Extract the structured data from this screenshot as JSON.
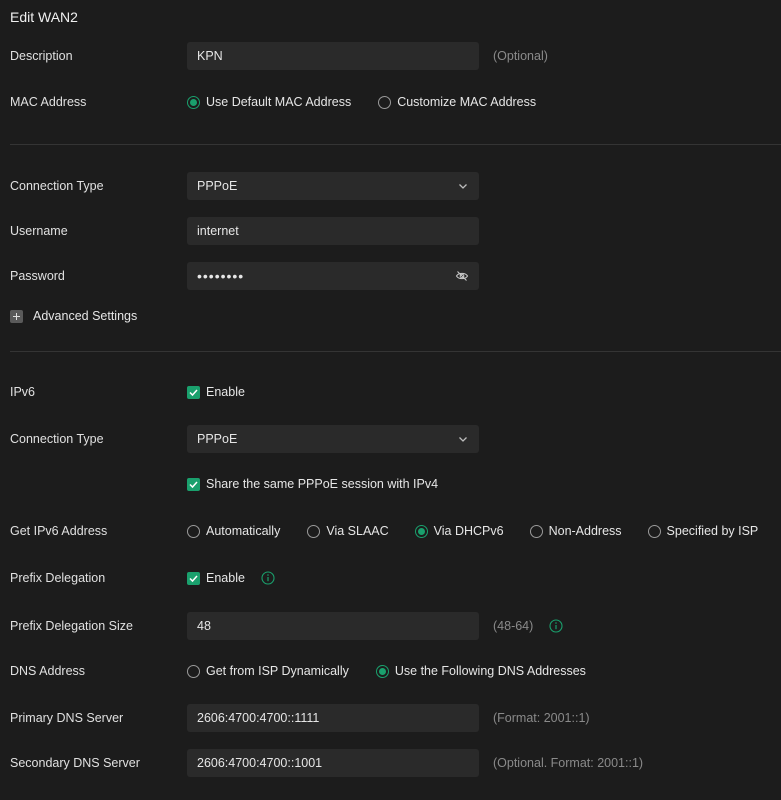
{
  "page": {
    "title": "Edit WAN2"
  },
  "description": {
    "label": "Description",
    "value": "KPN",
    "hint": "(Optional)"
  },
  "mac_address": {
    "label": "MAC Address",
    "options": [
      "Use Default MAC Address",
      "Customize MAC Address"
    ],
    "selected": "Use Default MAC Address"
  },
  "connection_type": {
    "label": "Connection Type",
    "value": "PPPoE"
  },
  "username": {
    "label": "Username",
    "value": "internet"
  },
  "password": {
    "label": "Password",
    "value": "••••••••",
    "icon": "eye-slash-icon"
  },
  "advanced": {
    "label": "Advanced Settings"
  },
  "ipv6": {
    "label": "IPv6",
    "checkbox_label": "Enable",
    "checked": true
  },
  "ipv6_connection_type": {
    "label": "Connection Type",
    "value": "PPPoE"
  },
  "share_session": {
    "label": "Share the same PPPoE session with IPv4",
    "checked": true
  },
  "get_ipv6_address": {
    "label": "Get IPv6 Address",
    "options": [
      "Automatically",
      "Via SLAAC",
      "Via DHCPv6",
      "Non-Address",
      "Specified by ISP"
    ],
    "selected": "Via DHCPv6"
  },
  "prefix_delegation": {
    "label": "Prefix Delegation",
    "checkbox_label": "Enable",
    "checked": true
  },
  "prefix_delegation_size": {
    "label": "Prefix Delegation Size",
    "value": "48",
    "hint": "(48-64)"
  },
  "dns_address": {
    "label": "DNS Address",
    "options": [
      "Get from ISP Dynamically",
      "Use the Following DNS Addresses"
    ],
    "selected": "Use the Following DNS Addresses"
  },
  "primary_dns": {
    "label": "Primary DNS Server",
    "value": "2606:4700:4700::1111",
    "hint": "(Format: 2001::1)"
  },
  "secondary_dns": {
    "label": "Secondary DNS Server",
    "value": "2606:4700:4700::1001",
    "hint": "(Optional. Format: 2001::1)"
  },
  "colors": {
    "accent": "#1aa06d",
    "background": "#1c1c1c",
    "field": "#2a2a2a"
  }
}
